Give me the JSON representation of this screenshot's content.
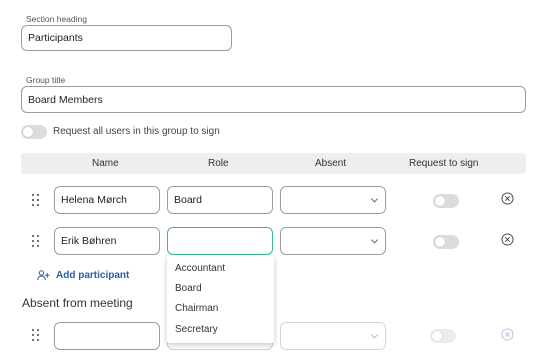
{
  "section": {
    "heading_label": "Section heading",
    "heading_value": "Participants"
  },
  "group": {
    "title_label": "Group title",
    "title_value": "Board Members",
    "request_all_label": "Request all users in this group to sign"
  },
  "table": {
    "headers": {
      "name": "Name",
      "role": "Role",
      "absent": "Absent",
      "request": "Request to sign"
    },
    "rows": [
      {
        "name": "Helena Mørch",
        "role": "Board",
        "absent": ""
      },
      {
        "name": "Erik Bøhren",
        "role": "",
        "absent": ""
      }
    ]
  },
  "role_dropdown": {
    "options": [
      "Accountant",
      "Board",
      "Chairman",
      "Secretary"
    ]
  },
  "add_participant_label": "Add participant",
  "absent_section": {
    "heading": "Absent from meeting",
    "rows": [
      {
        "name": "",
        "role": "",
        "absent": ""
      }
    ]
  },
  "colors": {
    "accent_focus": "#39b79a",
    "link": "#2b5fa6"
  }
}
